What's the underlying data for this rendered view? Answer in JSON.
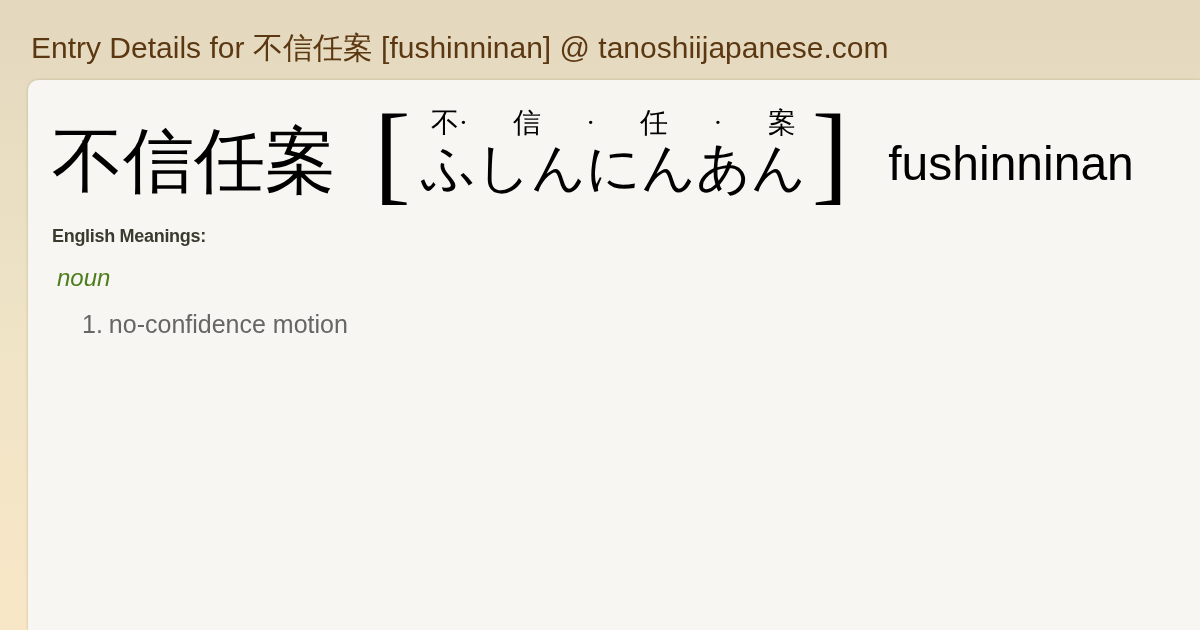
{
  "site_title": "Entry Details for 不信任案 [fushinninan] @ tanoshiijapanese.com",
  "entry": {
    "word": "不信任案",
    "open_bracket": "[",
    "ruby": [
      "不·",
      "信",
      "·",
      "任",
      "·",
      "案"
    ],
    "reading": "ふしんにんあん",
    "close_bracket": "]",
    "romaji": "fushinninan"
  },
  "meanings_heading": "English Meanings:",
  "part_of_speech": "noun",
  "meanings": [
    {
      "number": "1.",
      "text": "no-confidence motion"
    }
  ]
}
